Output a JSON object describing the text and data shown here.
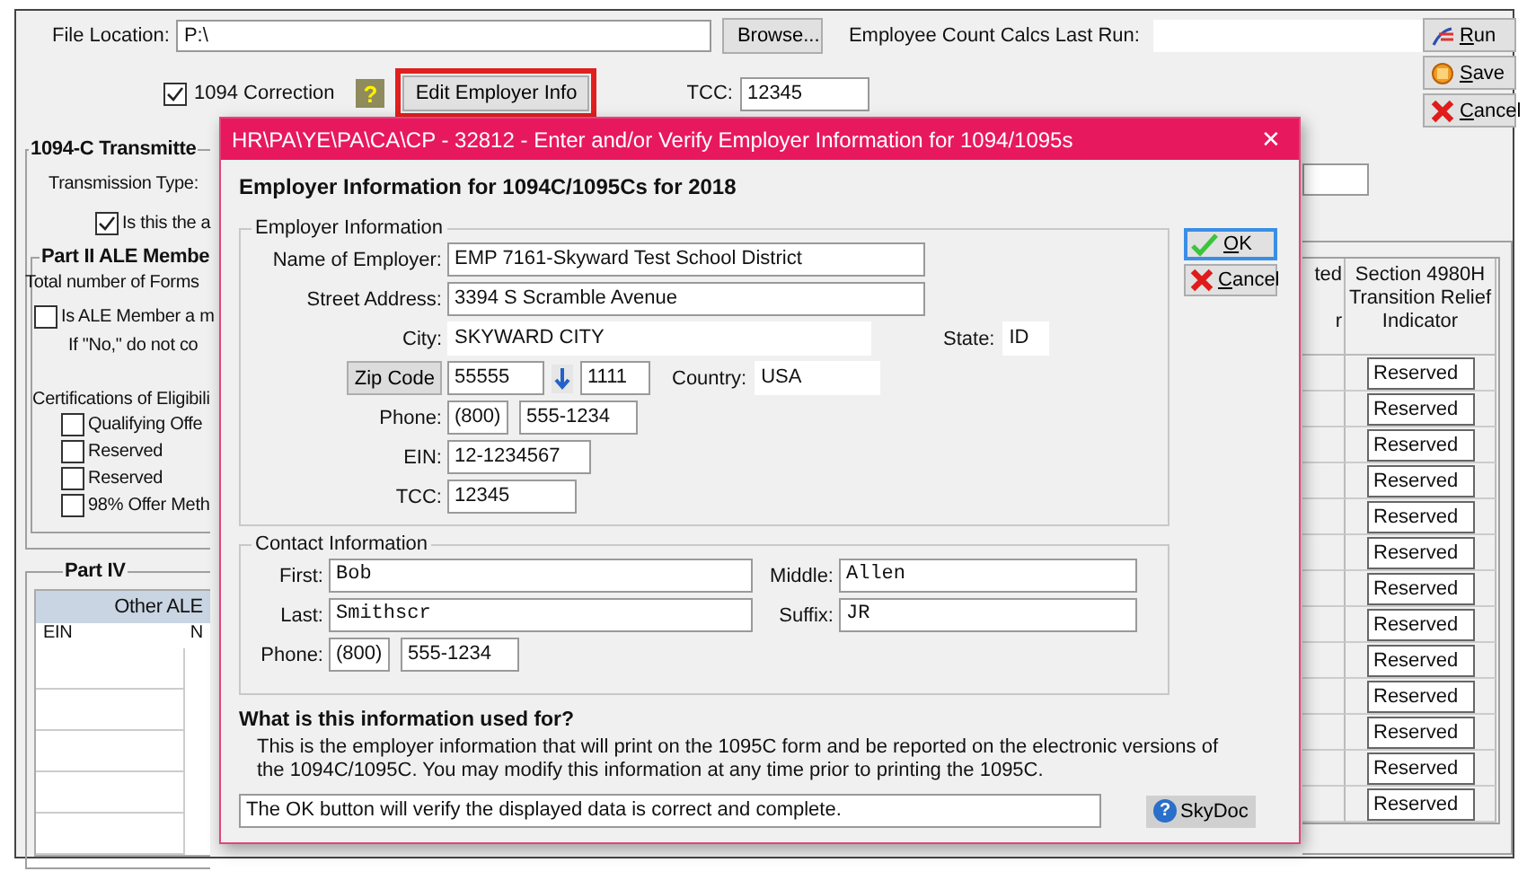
{
  "main_window": {
    "file_location": {
      "label": "File Location:",
      "value": "P:\\"
    },
    "browse_button": {
      "label": "Browse..."
    },
    "employee_count_calcs": {
      "label": "Employee Count Calcs Last Run:"
    },
    "correction": {
      "label": "1094 Correction",
      "checked": true
    },
    "help_icon": {
      "glyph": "?"
    },
    "edit_employer_button": {
      "label": "Edit Employer Info",
      "highlighted": true
    },
    "tcc": {
      "label": "TCC:",
      "value": "12345"
    },
    "toolbar": [
      {
        "kind": "run",
        "label": "Run"
      },
      {
        "kind": "save",
        "label": "Save"
      },
      {
        "kind": "cancel",
        "label": "Cancel"
      }
    ],
    "transmittal": {
      "title": "1094-C Transmitte",
      "transmission_type_label": "Transmission Type:",
      "authoritative": {
        "label": "Is this the a",
        "checked": true
      }
    },
    "part_ii": {
      "title": "Part II ALE Membe",
      "total_forms_label": "Total number of Forms",
      "ale_member": {
        "label": "Is ALE Member a m",
        "checked": false
      },
      "note": "If \"No,\" do not co",
      "certifications_label": "Certifications of Eligibili",
      "certifications": [
        {
          "label": "Qualifying Offe",
          "checked": false
        },
        {
          "label": "Reserved",
          "checked": false
        },
        {
          "label": "Reserved",
          "checked": false
        },
        {
          "label": "98% Offer Meth",
          "checked": false
        }
      ]
    },
    "part_iv": {
      "title": "Part IV",
      "table_title": "Other ALE",
      "columns": [
        "EIN",
        "N"
      ]
    },
    "relief_table": {
      "column_1_header": [
        "ted",
        "r"
      ],
      "column_2_header": "Section 4980H Transition Relief Indicator",
      "rows": [
        "Reserved",
        "Reserved",
        "Reserved",
        "Reserved",
        "Reserved",
        "Reserved",
        "Reserved",
        "Reserved",
        "Reserved",
        "Reserved",
        "Reserved",
        "Reserved",
        "Reserved"
      ]
    }
  },
  "dialog": {
    "title": "HR\\PA\\YE\\PA\\CA\\CP - 32812 - Enter and/or Verify Employer Information for 1094/1095s",
    "close_glyph": "✕",
    "heading": "Employer Information for 1094C/1095Cs for 2018",
    "employer_group": {
      "title": "Employer Information",
      "name": {
        "label": "Name of Employer:",
        "value": "EMP 7161-Skyward Test School District"
      },
      "street": {
        "label": "Street Address:",
        "value": "3394 S Scramble Avenue"
      },
      "city": {
        "label": "City:",
        "value": "SKYWARD CITY"
      },
      "state": {
        "label": "State:",
        "value": "ID"
      },
      "zip": {
        "button": "Zip Code",
        "value": "55555",
        "extension": "1111"
      },
      "country": {
        "label": "Country:",
        "value": "USA"
      },
      "phone": {
        "label": "Phone:",
        "area_code": "(800)",
        "number": "555-1234"
      },
      "ein": {
        "label": "EIN:",
        "value": "12-1234567"
      },
      "tcc": {
        "label": "TCC:",
        "value": "12345"
      }
    },
    "contact_group": {
      "title": "Contact Information",
      "first": {
        "label": "First:",
        "value": "Bob"
      },
      "middle": {
        "label": "Middle:",
        "value": "Allen"
      },
      "last": {
        "label": "Last:",
        "value": "Smithscr"
      },
      "suffix": {
        "label": "Suffix:",
        "value": "JR"
      },
      "phone": {
        "label": "Phone:",
        "area_code": "(800)",
        "number": "555-1234"
      }
    },
    "buttons": [
      {
        "kind": "ok",
        "label": "OK",
        "focused": true
      },
      {
        "kind": "cancel",
        "label": "Cancel",
        "focused": false
      }
    ],
    "help_heading": "What is this information used for?",
    "help_text": "This is the employer information that will print on the 1095C form and be reported on the electronic versions of the 1094C/1095C. You may modify this information at any time prior to printing the 1095C.",
    "status": "The OK button will verify the displayed data is correct and complete.",
    "skydoc_button": {
      "glyph": "?",
      "label": "SkyDoc"
    }
  }
}
